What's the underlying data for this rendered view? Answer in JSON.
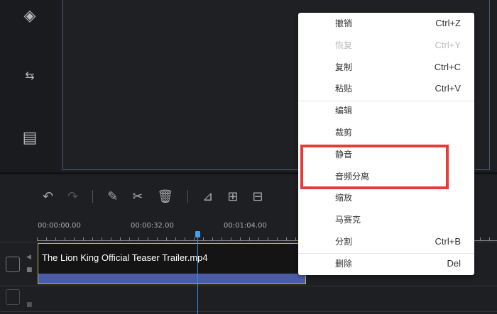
{
  "sidebar": {
    "icons": [
      "layers-icon",
      "swap-arrows-icon",
      "film-icon"
    ]
  },
  "toolbar": {
    "icons": [
      "undo-icon",
      "redo-icon",
      "edit-icon",
      "cut-icon",
      "delete-icon",
      "crop-icon",
      "zoom-frame-icon",
      "split-icon"
    ]
  },
  "ruler": {
    "labels": [
      "00:00:00.00",
      "00:00:32.00",
      "00:01:04.00"
    ]
  },
  "timeline": {
    "clip_title": "The Lion King Official Teaser Trailer.mp4",
    "playhead_time_fraction": 0.55
  },
  "menu": {
    "items": [
      {
        "label": "撤销",
        "shortcut": "Ctrl+Z"
      },
      {
        "label": "恢复",
        "shortcut": "Ctrl+Y",
        "disabled": true
      },
      {
        "label": "复制",
        "shortcut": "Ctrl+C"
      },
      {
        "label": "粘贴",
        "shortcut": "Ctrl+V"
      },
      {
        "label": "编辑",
        "shortcut": ""
      },
      {
        "label": "裁剪",
        "shortcut": ""
      },
      {
        "label": "静音",
        "shortcut": ""
      },
      {
        "label": "音频分离",
        "shortcut": ""
      },
      {
        "label": "缩放",
        "shortcut": ""
      },
      {
        "label": "马赛克",
        "shortcut": ""
      },
      {
        "label": "分割",
        "shortcut": "Ctrl+B"
      },
      {
        "label": "删除",
        "shortcut": "Del"
      }
    ]
  },
  "colors": {
    "highlight": "#e83a3a",
    "playhead": "#3a8fd8",
    "audio_bar": "#4a5ca8"
  }
}
